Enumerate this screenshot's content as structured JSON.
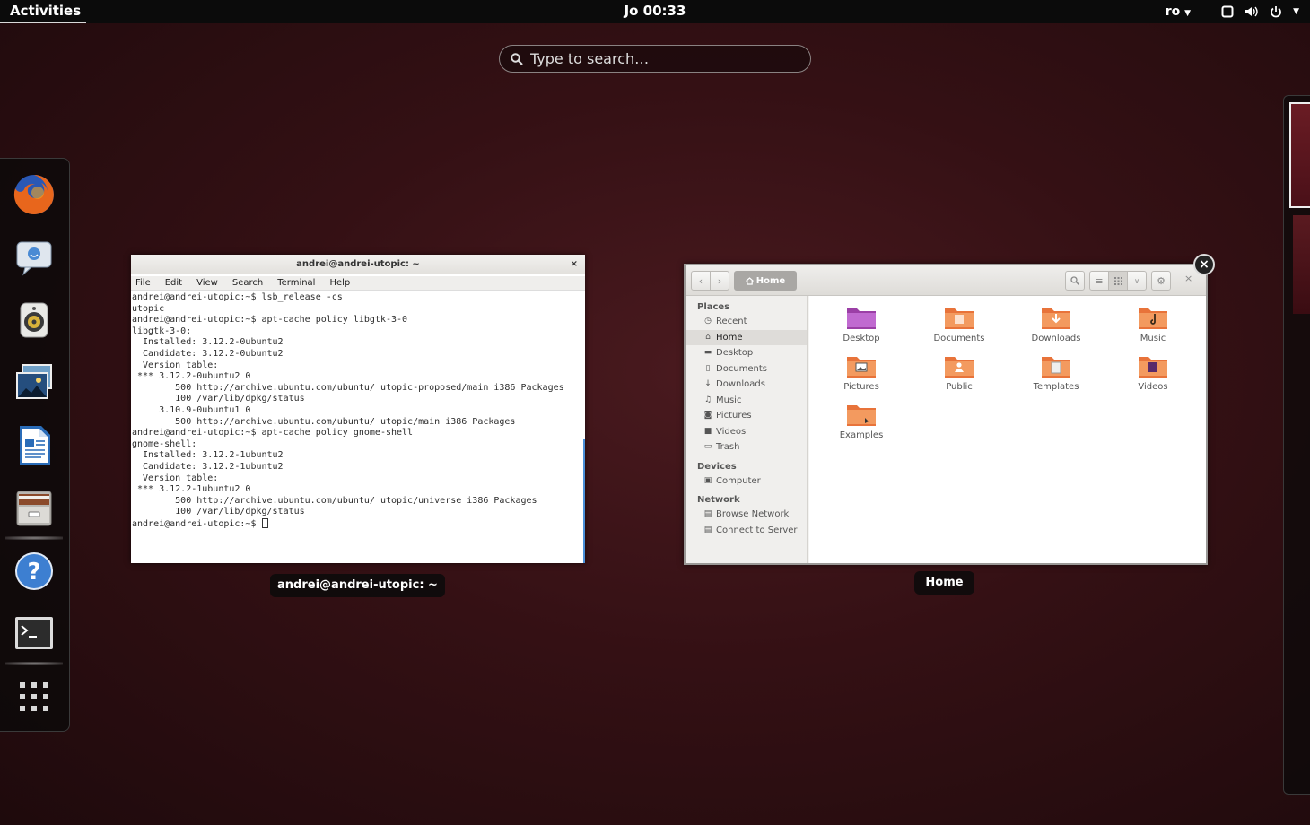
{
  "topbar": {
    "activities": "Activities",
    "clock": "Jo 00:33",
    "language": "ro"
  },
  "search": {
    "placeholder": "Type to search…"
  },
  "dash": {
    "items": [
      "firefox-icon",
      "empathy-icon",
      "rhythmbox-icon",
      "shotwell-icon",
      "libreoffice-writer-icon",
      "files-icon",
      "help-icon",
      "terminal-icon",
      "show-apps-icon"
    ]
  },
  "terminal": {
    "title": "andrei@andrei-utopic: ~",
    "caption": "andrei@andrei-utopic: ~",
    "menu": [
      "File",
      "Edit",
      "View",
      "Search",
      "Terminal",
      "Help"
    ],
    "lines": [
      "andrei@andrei-utopic:~$ lsb_release -cs",
      "utopic",
      "andrei@andrei-utopic:~$ apt-cache policy libgtk-3-0",
      "libgtk-3-0:",
      "  Installed: 3.12.2-0ubuntu2",
      "  Candidate: 3.12.2-0ubuntu2",
      "  Version table:",
      " *** 3.12.2-0ubuntu2 0",
      "        500 http://archive.ubuntu.com/ubuntu/ utopic-proposed/main i386 Packages",
      "        100 /var/lib/dpkg/status",
      "     3.10.9-0ubuntu1 0",
      "        500 http://archive.ubuntu.com/ubuntu/ utopic/main i386 Packages",
      "andrei@andrei-utopic:~$ apt-cache policy gnome-shell",
      "gnome-shell:",
      "  Installed: 3.12.2-1ubuntu2",
      "  Candidate: 3.12.2-1ubuntu2",
      "  Version table:",
      " *** 3.12.2-1ubuntu2 0",
      "        500 http://archive.ubuntu.com/ubuntu/ utopic/universe i386 Packages",
      "        100 /var/lib/dpkg/status"
    ],
    "prompt": "andrei@andrei-utopic:~$ "
  },
  "files": {
    "caption": "Home",
    "location": "Home",
    "sidebar": {
      "places_heading": "Places",
      "places": [
        "Recent",
        "Home",
        "Desktop",
        "Documents",
        "Downloads",
        "Music",
        "Pictures",
        "Videos",
        "Trash"
      ],
      "devices_heading": "Devices",
      "devices": [
        "Computer"
      ],
      "network_heading": "Network",
      "network": [
        "Browse Network",
        "Connect to Server"
      ]
    },
    "folders": [
      "Desktop",
      "Documents",
      "Downloads",
      "Music",
      "Pictures",
      "Public",
      "Templates",
      "Videos",
      "Examples"
    ]
  },
  "colors": {
    "folder_orange": "#e8733a",
    "desktop_purple": "#9b3fa6",
    "panel_black": "#0b0b0b"
  }
}
